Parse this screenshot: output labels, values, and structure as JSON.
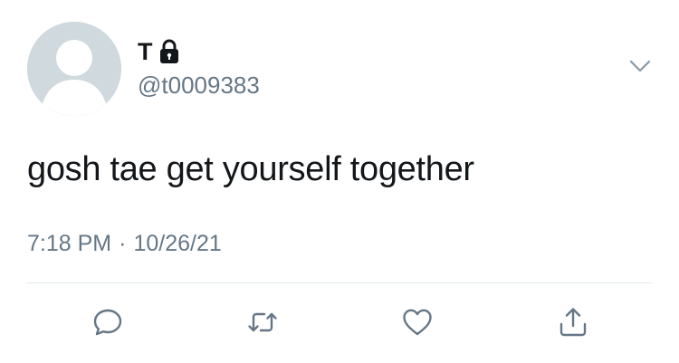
{
  "colors": {
    "text_primary": "#14171a",
    "text_secondary": "#657786",
    "avatar_bg": "#cfd9de",
    "divider": "#e1e8ed"
  },
  "user": {
    "display_name": "T",
    "handle": "@t0009383",
    "protected_icon": "lock-icon",
    "avatar_icon": "default-avatar-icon"
  },
  "tweet": {
    "text": "gosh tae get yourself together",
    "time": "7:18 PM",
    "separator": "·",
    "date": "10/26/21"
  },
  "menu": {
    "icon": "chevron-down-icon"
  },
  "actions": [
    {
      "name": "reply",
      "icon": "reply-icon"
    },
    {
      "name": "retweet",
      "icon": "retweet-icon"
    },
    {
      "name": "like",
      "icon": "heart-icon"
    },
    {
      "name": "share",
      "icon": "share-icon"
    }
  ]
}
